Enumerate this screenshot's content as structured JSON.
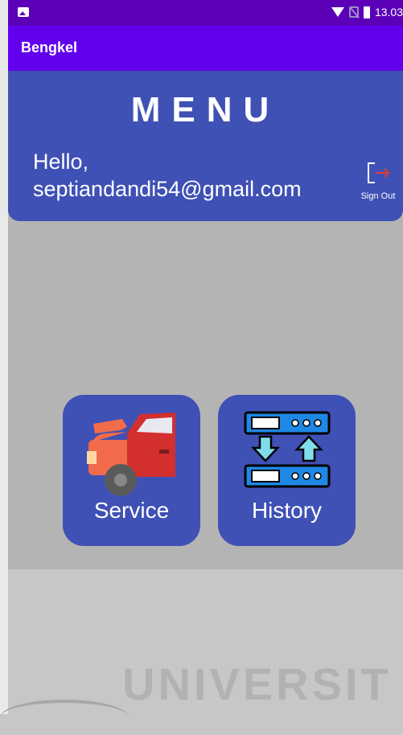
{
  "status_bar": {
    "time": "13.03",
    "icons": [
      "gallery-icon",
      "wifi-icon",
      "no-sim-icon",
      "battery-icon"
    ]
  },
  "app_bar": {
    "title": "Bengkel"
  },
  "header": {
    "menu_title": "MENU",
    "greeting_line1": "Hello,",
    "greeting_email": "septiandandi54@gmail.com",
    "sign_out_label": "Sign Out"
  },
  "tiles": [
    {
      "label": "Service",
      "icon": "car-repair-icon"
    },
    {
      "label": "History",
      "icon": "server-transfer-icon"
    }
  ],
  "watermark": "UNIVERSIT",
  "colors": {
    "primary": "#6200ee",
    "primary_dark": "#5c00b8",
    "card": "#3f51b5",
    "background": "#b4b4b4"
  }
}
